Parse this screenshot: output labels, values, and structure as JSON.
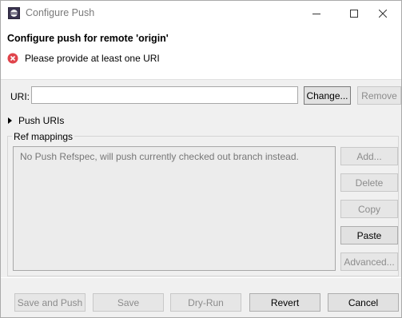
{
  "window": {
    "title": "Configure Push",
    "controls": {
      "minimize": "minimize",
      "maximize": "maximize",
      "close": "close"
    }
  },
  "header": {
    "title": "Configure push for remote 'origin'",
    "error": "Please provide at least one URI"
  },
  "uri": {
    "label": "URI:",
    "value": "",
    "change_label": "Change...",
    "remove_label": "Remove"
  },
  "push_uris": {
    "label": "Push URIs",
    "expanded": false
  },
  "ref_mappings": {
    "label": "Ref mappings",
    "empty_message": "No Push Refspec, will push currently checked out branch instead.",
    "buttons": {
      "add": "Add...",
      "delete": "Delete",
      "copy": "Copy",
      "paste": "Paste",
      "advanced": "Advanced..."
    }
  },
  "footer": {
    "save_and_push": "Save and Push",
    "save": "Save",
    "dry_run": "Dry-Run",
    "revert": "Revert",
    "cancel": "Cancel"
  },
  "icons": {
    "app": "eclipse-app-icon",
    "error": "error-icon",
    "expander": "chevron-right-icon"
  },
  "colors": {
    "error": "#e0444b",
    "disabled_text": "#8c8c8c"
  }
}
